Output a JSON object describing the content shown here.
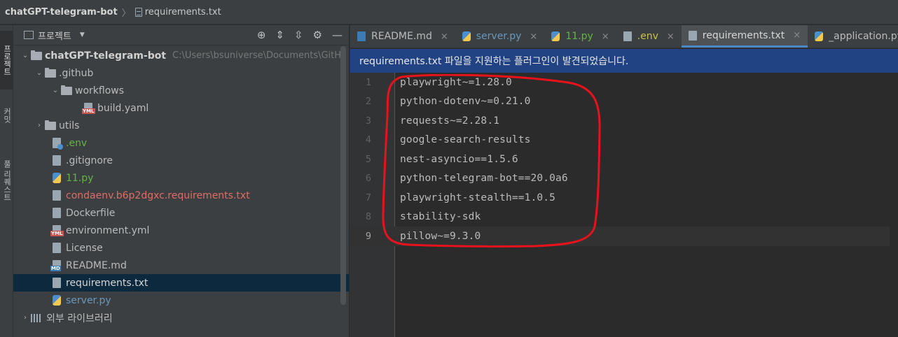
{
  "breadcrumb": {
    "project": "chatGPT-telegram-bot",
    "file": "requirements.txt"
  },
  "side_tabs": [
    {
      "label": "프로젝트",
      "active": true
    },
    {
      "label": "커밋",
      "active": false
    },
    {
      "label": "풀 리퀘스트",
      "active": false
    }
  ],
  "project_panel": {
    "title": "프로젝트",
    "tree": [
      {
        "label": "chatGPT-telegram-bot",
        "path": "C:\\Users\\bsuniverse\\Documents\\GitH",
        "type": "folder-root",
        "expanded": true
      },
      {
        "label": ".github",
        "type": "folder",
        "expanded": true
      },
      {
        "label": "workflows",
        "type": "folder",
        "expanded": true
      },
      {
        "label": "build.yaml",
        "type": "yml"
      },
      {
        "label": "utils",
        "type": "folder",
        "expanded": false
      },
      {
        "label": ".env",
        "type": "env",
        "color": "green"
      },
      {
        "label": ".gitignore",
        "type": "file"
      },
      {
        "label": "11.py",
        "type": "py",
        "color": "green"
      },
      {
        "label": "condaenv.b6p2dgxc.requirements.txt",
        "type": "file",
        "color": "red"
      },
      {
        "label": "Dockerfile",
        "type": "file"
      },
      {
        "label": "environment.yml",
        "type": "yml"
      },
      {
        "label": "License",
        "type": "file"
      },
      {
        "label": "README.md",
        "type": "md"
      },
      {
        "label": "requirements.txt",
        "type": "file",
        "selected": true
      },
      {
        "label": "server.py",
        "type": "py",
        "color": "blue"
      },
      {
        "label": "외부 라이브러리",
        "type": "libs",
        "expanded": false
      }
    ]
  },
  "tabs": [
    {
      "label": "README.md",
      "icon": "md-icon",
      "color": "default"
    },
    {
      "label": "server.py",
      "icon": "python-icon",
      "color": "blue"
    },
    {
      "label": "11.py",
      "icon": "python-icon",
      "color": "green"
    },
    {
      "label": ".env",
      "icon": "env-icon",
      "color": "yellow"
    },
    {
      "label": "requirements.txt",
      "icon": "text-file-icon",
      "color": "default",
      "active": true
    },
    {
      "label": "_application.py",
      "icon": "python-icon",
      "color": "default"
    }
  ],
  "banner": {
    "text": "requirements.txt 파일을 지원하는 플러그인이 발견되었습니다."
  },
  "editor": {
    "lines": [
      {
        "n": "1",
        "text": "playwright~=1.28.0"
      },
      {
        "n": "2",
        "text": "python-dotenv~=0.21.0"
      },
      {
        "n": "3",
        "text": "requests~=2.28.1"
      },
      {
        "n": "4",
        "text": "google-search-results"
      },
      {
        "n": "5",
        "text": "nest-asyncio==1.5.6"
      },
      {
        "n": "6",
        "text": "python-telegram-bot==20.0a6"
      },
      {
        "n": "7",
        "text": "playwright-stealth==1.0.5"
      },
      {
        "n": "8",
        "text": "stability-sdk"
      },
      {
        "n": "9",
        "text": "pillow~=9.3.0"
      }
    ],
    "current_line": 9
  },
  "colors": {
    "annotation": "#e8121c",
    "selection": "#0d293e",
    "accent": "#4a88c7",
    "banner": "#214283"
  }
}
